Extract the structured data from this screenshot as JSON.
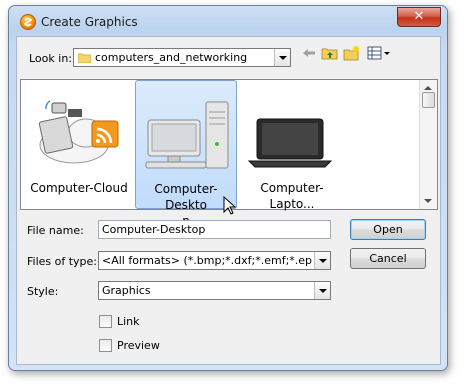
{
  "window": {
    "title": "Create Graphics",
    "close_label": "✕"
  },
  "look_in": {
    "label": "Look in:",
    "value": "computers_and_networking"
  },
  "items": [
    {
      "caption": "Computer-Cloud",
      "selected": false
    },
    {
      "caption": "Computer-Deskto\np",
      "selected": true
    },
    {
      "caption": "Computer-Lapto...",
      "selected": false
    }
  ],
  "file_name": {
    "label": "File name:",
    "value": "Computer-Desktop"
  },
  "files_of_type": {
    "label": "Files of type:",
    "value": "<All formats> (*.bmp;*.dxf;*.emf;*.eps;*.gif;*.jp"
  },
  "style": {
    "label": "Style:",
    "value": "Graphics"
  },
  "options": {
    "link_label": "Link",
    "preview_label": "Preview"
  },
  "buttons": {
    "open": "Open",
    "cancel": "Cancel"
  }
}
